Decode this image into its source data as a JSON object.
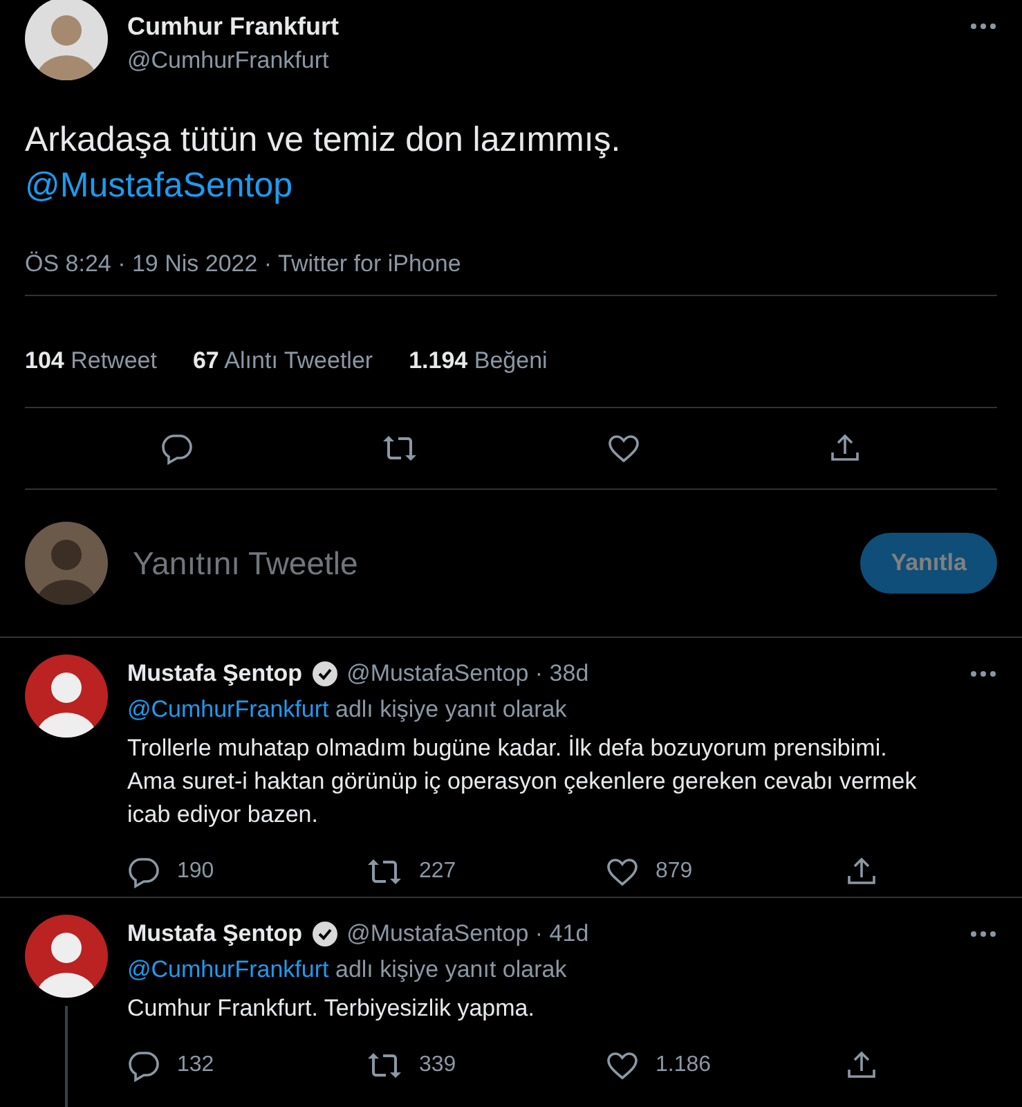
{
  "tweet": {
    "name": "Cumhur Frankfurt",
    "handle": "@CumhurFrankfurt",
    "text": "Arkadaşa tütün ve temiz don lazımmış.",
    "mention": "@MustafaSentop",
    "meta": "ÖS 8:24 · 19 Nis 2022 · Twitter for iPhone",
    "stats": [
      "**104** Retweet",
      "**67** Alıntı Tweetler",
      "**1.194** Beğeni"
    ]
  },
  "compose": {
    "placeholder": "Yanıtını Tweetle",
    "button": "Yanıtla",
    "disabled": true
  },
  "replies": [
    {
      "name": "Mustafa Şentop",
      "verified": true,
      "handle": "@MustafaSentop · 38d",
      "reply_to": "@CumhurFrankfurt",
      "reply_note": "adlı kişiye yanıt olarak",
      "text": "Trollerle muhatap olmadım bugüne kadar. İlk defa bozuyorum prensibimi. Ama suret-i haktan görünüp iç operasyon çekenlere gereken cevabı vermek icab ediyor bazen.",
      "replies": "190",
      "retweets": "227",
      "likes": "879",
      "thread_line": false
    },
    {
      "name": "Mustafa Şentop",
      "verified": true,
      "handle": "@MustafaSentop · 41d",
      "reply_to": "@CumhurFrankfurt",
      "reply_note": "adlı kişiye yanıt olarak",
      "text": "Cumhur Frankfurt. Terbiyesizlik yapma.",
      "replies": "132",
      "retweets": "339",
      "likes": "1.186",
      "thread_line": true
    }
  ]
}
